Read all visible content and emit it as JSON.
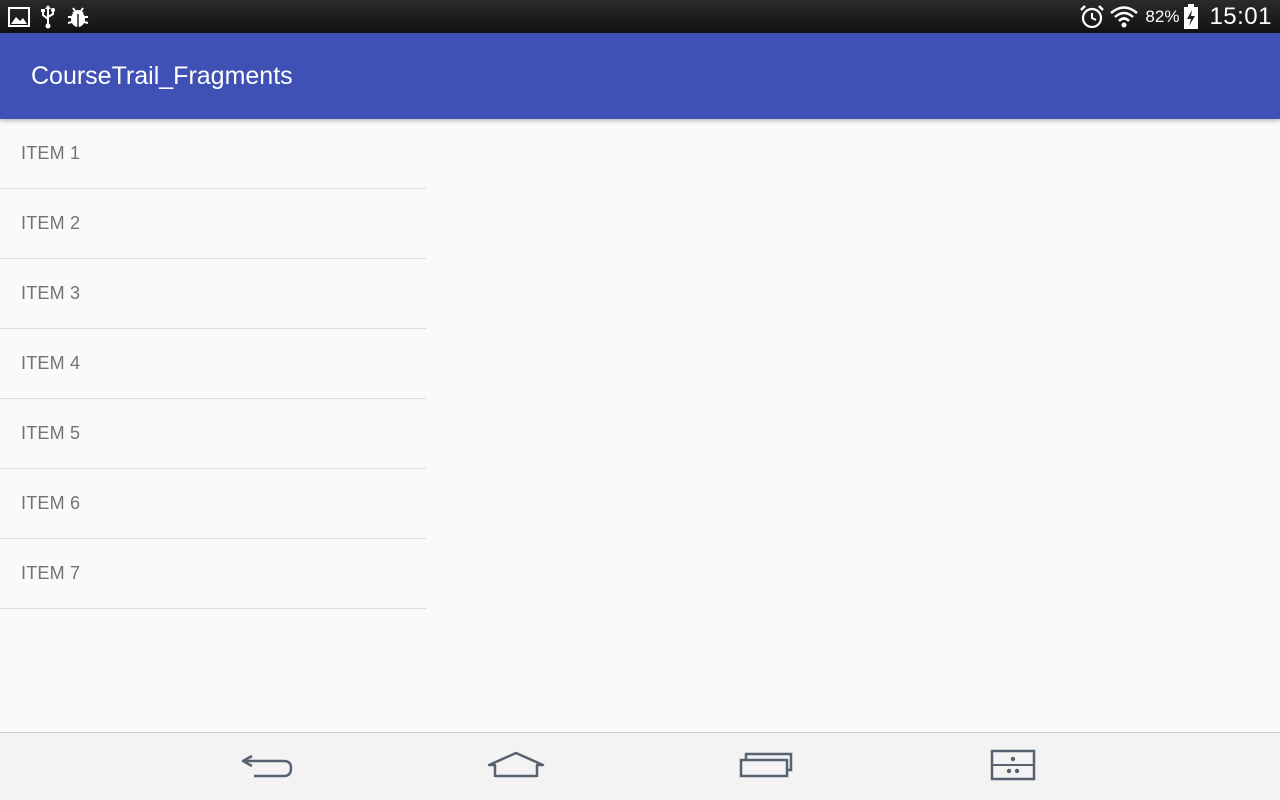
{
  "status_bar": {
    "left_icons": [
      "gallery-icon",
      "usb-icon",
      "debug-icon"
    ],
    "right_icons": [
      "alarm-icon",
      "wifi-icon",
      "battery-charging-icon"
    ],
    "battery_percent": "82%",
    "time": "15:01"
  },
  "app_bar": {
    "title": "CourseTrail_Fragments",
    "color": "#3f51b5"
  },
  "list": {
    "items": [
      {
        "label": "ITEM 1"
      },
      {
        "label": "ITEM 2"
      },
      {
        "label": "ITEM 3"
      },
      {
        "label": "ITEM 4"
      },
      {
        "label": "ITEM 5"
      },
      {
        "label": "ITEM 6"
      },
      {
        "label": "ITEM 7"
      }
    ]
  },
  "nav_bar": {
    "buttons": [
      "back-icon",
      "home-icon",
      "recents-icon",
      "dual-window-icon"
    ]
  }
}
